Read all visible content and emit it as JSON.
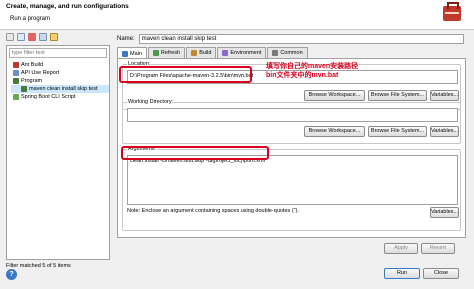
{
  "header": {
    "title": "Create, manage, and run configurations",
    "subtitle": "Run a program"
  },
  "left": {
    "filter_placeholder": "type filter text",
    "tree": [
      {
        "label": "Ant Build",
        "level": 1,
        "selected": false,
        "icon": "ant-icon",
        "color": "#c0392b"
      },
      {
        "label": "API Use Report",
        "level": 1,
        "selected": false,
        "icon": "report-icon",
        "color": "#6a8fc7"
      },
      {
        "label": "Program",
        "level": 1,
        "selected": false,
        "icon": "program-icon",
        "color": "#4a7a3a"
      },
      {
        "label": "maven clean install skip test",
        "level": 2,
        "selected": true,
        "icon": "program-icon",
        "color": "#4a7a3a"
      },
      {
        "label": "Spring Boot CLI Script",
        "level": 1,
        "selected": false,
        "icon": "spring-icon",
        "color": "#6aa84f"
      }
    ],
    "status": "Filter matched 5 of 5 items"
  },
  "main": {
    "name_label": "Name:",
    "name_value": "maven clean install skip test",
    "tabs": [
      {
        "label": "Main",
        "icon": "main-icon",
        "active": true
      },
      {
        "label": "Refresh",
        "icon": "refresh-icon",
        "active": false
      },
      {
        "label": "Build",
        "icon": "build-icon",
        "active": false
      },
      {
        "label": "Environment",
        "icon": "environment-icon",
        "active": false
      },
      {
        "label": "Common",
        "icon": "common-icon",
        "active": false
      }
    ],
    "location": {
      "label": "Location:",
      "value": "D:\\Program Files\\apache-maven-3.2.5\\bin\\mvn.bat"
    },
    "working_dir": {
      "label": "Working Directory:",
      "value": ""
    },
    "arguments": {
      "label": "Arguments:",
      "value": "clean install -Dmaven.test.skip -f${project_loc}\\pom.xml"
    },
    "buttons": {
      "browse_workspace": "Browse Workspace...",
      "browse_file_system": "Browse File System...",
      "variables": "Variables..."
    },
    "note": "Note: Enclose an argument containing spaces using double-quotes (\").",
    "annotation_line1": "填写你自己的maven安装路径",
    "annotation_line2": "bin文件夹中的mvn.bat"
  },
  "actions": {
    "apply": "Apply",
    "revert": "Revert",
    "run": "Run",
    "close": "Close"
  },
  "colors": {
    "highlight": "#d8001c",
    "selection": "#cde6ff"
  }
}
